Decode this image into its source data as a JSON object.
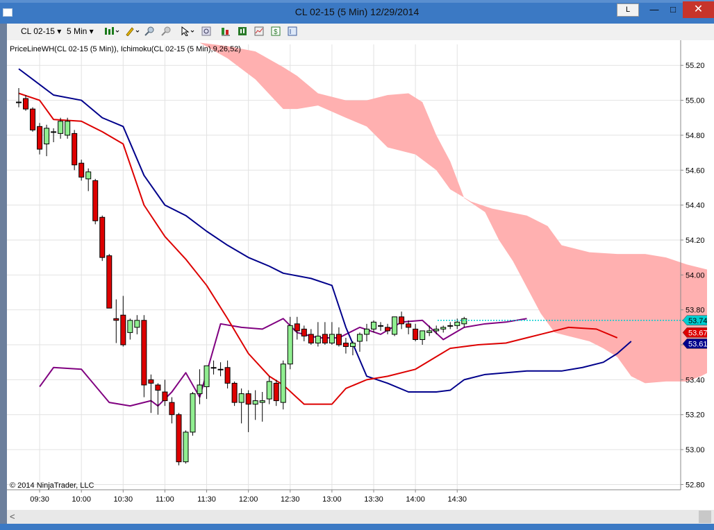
{
  "window": {
    "title": "CL 02-15 (5 Min)  12/29/2014",
    "l_button_label": "L",
    "minimize_icon": "minimize-icon",
    "maximize_icon": "maximize-icon",
    "close_icon": "close-icon"
  },
  "toolbar": {
    "instrument": "CL 02-15",
    "interval": "5 Min",
    "icons": [
      "bar-type-icon",
      "pencil-icon",
      "zoom-in-icon",
      "zoom-out-icon",
      "cursor-icon",
      "magnifier-icon",
      "properties-icon",
      "strategy-icon",
      "chart-trader-icon",
      "dollar-icon",
      "data-box-icon"
    ]
  },
  "colors": {
    "bull_candle": "#90ee90",
    "bear_candle": "#dd0000",
    "kumo_cloud": "#ffb0b0",
    "kijun": "#00008b",
    "tenkan": "#dd0000",
    "chikou": "#800080",
    "priceline": "#00ced1"
  },
  "chart_data": {
    "type": "candlestick",
    "indicator_label": "PriceLineWH(CL 02-15 (5 Min)),  Ichimoku(CL 02-15 (5 Min),9,26,52)",
    "copyright": "© 2014 NinjaTrader, LLC",
    "x_tick_labels": [
      "09:30",
      "10:00",
      "10:30",
      "11:00",
      "11:30",
      "12:00",
      "12:30",
      "13:00",
      "13:30",
      "14:00",
      "14:30"
    ],
    "y_tick_labels": [
      "55.20",
      "55.00",
      "54.80",
      "54.60",
      "54.40",
      "54.20",
      "54.00",
      "53.80",
      "53.60",
      "53.40",
      "53.20",
      "53.00",
      "52.80"
    ],
    "ylim": [
      52.77,
      55.32
    ],
    "grid": true,
    "start_time": "09:15",
    "bar_minutes": 5,
    "candles": [
      {
        "o": 54.99,
        "h": 55.07,
        "l": 54.96,
        "c": 54.99
      },
      {
        "o": 55.01,
        "h": 55.03,
        "l": 54.94,
        "c": 54.95
      },
      {
        "o": 54.95,
        "h": 54.96,
        "l": 54.82,
        "c": 54.83
      },
      {
        "o": 54.85,
        "h": 54.87,
        "l": 54.69,
        "c": 54.72
      },
      {
        "o": 54.75,
        "h": 54.86,
        "l": 54.68,
        "c": 54.84
      },
      {
        "o": 54.82,
        "h": 54.84,
        "l": 54.76,
        "c": 54.82
      },
      {
        "o": 54.81,
        "h": 54.9,
        "l": 54.78,
        "c": 54.88
      },
      {
        "o": 54.8,
        "h": 54.9,
        "l": 54.78,
        "c": 54.88
      },
      {
        "o": 54.81,
        "h": 54.83,
        "l": 54.6,
        "c": 54.63
      },
      {
        "o": 54.64,
        "h": 54.66,
        "l": 54.54,
        "c": 54.56
      },
      {
        "o": 54.55,
        "h": 54.61,
        "l": 54.48,
        "c": 54.59
      },
      {
        "o": 54.54,
        "h": 54.55,
        "l": 54.29,
        "c": 54.31
      },
      {
        "o": 54.33,
        "h": 54.34,
        "l": 54.08,
        "c": 54.1
      },
      {
        "o": 54.11,
        "h": 54.12,
        "l": 53.81,
        "c": 53.81
      },
      {
        "o": 53.75,
        "h": 53.86,
        "l": 53.61,
        "c": 53.74
      },
      {
        "o": 53.77,
        "h": 53.88,
        "l": 53.59,
        "c": 53.6
      },
      {
        "o": 53.67,
        "h": 53.75,
        "l": 53.63,
        "c": 53.74
      },
      {
        "o": 53.7,
        "h": 53.77,
        "l": 53.66,
        "c": 53.74
      },
      {
        "o": 53.74,
        "h": 53.77,
        "l": 53.3,
        "c": 53.37
      },
      {
        "o": 53.4,
        "h": 53.43,
        "l": 53.21,
        "c": 53.38
      },
      {
        "o": 53.37,
        "h": 53.38,
        "l": 53.2,
        "c": 53.34
      },
      {
        "o": 53.33,
        "h": 53.4,
        "l": 53.25,
        "c": 53.28
      },
      {
        "o": 53.27,
        "h": 53.3,
        "l": 53.15,
        "c": 53.2
      },
      {
        "o": 53.2,
        "h": 53.21,
        "l": 52.91,
        "c": 52.93
      },
      {
        "o": 52.93,
        "h": 53.11,
        "l": 52.92,
        "c": 53.1
      },
      {
        "o": 53.1,
        "h": 53.33,
        "l": 53.08,
        "c": 53.32
      },
      {
        "o": 53.32,
        "h": 53.46,
        "l": 53.26,
        "c": 53.37
      },
      {
        "o": 53.36,
        "h": 53.48,
        "l": 53.29,
        "c": 53.48
      },
      {
        "o": 53.47,
        "h": 53.51,
        "l": 53.43,
        "c": 53.47
      },
      {
        "o": 53.46,
        "h": 53.5,
        "l": 53.42,
        "c": 53.46
      },
      {
        "o": 53.47,
        "h": 53.51,
        "l": 53.35,
        "c": 53.38
      },
      {
        "o": 53.38,
        "h": 53.39,
        "l": 53.25,
        "c": 53.27
      },
      {
        "o": 53.27,
        "h": 53.35,
        "l": 53.15,
        "c": 53.32
      },
      {
        "o": 53.32,
        "h": 53.34,
        "l": 53.1,
        "c": 53.26
      },
      {
        "o": 53.26,
        "h": 53.34,
        "l": 53.17,
        "c": 53.28
      },
      {
        "o": 53.27,
        "h": 53.33,
        "l": 53.16,
        "c": 53.28
      },
      {
        "o": 53.29,
        "h": 53.42,
        "l": 53.26,
        "c": 53.39
      },
      {
        "o": 53.38,
        "h": 53.4,
        "l": 53.25,
        "c": 53.28
      },
      {
        "o": 53.27,
        "h": 53.51,
        "l": 53.23,
        "c": 53.49
      },
      {
        "o": 53.49,
        "h": 53.76,
        "l": 53.46,
        "c": 53.71
      },
      {
        "o": 53.72,
        "h": 53.76,
        "l": 53.63,
        "c": 53.68
      },
      {
        "o": 53.69,
        "h": 53.71,
        "l": 53.62,
        "c": 53.65
      },
      {
        "o": 53.66,
        "h": 53.69,
        "l": 53.6,
        "c": 53.61
      },
      {
        "o": 53.61,
        "h": 53.73,
        "l": 53.59,
        "c": 53.65
      },
      {
        "o": 53.66,
        "h": 53.73,
        "l": 53.6,
        "c": 53.61
      },
      {
        "o": 53.61,
        "h": 53.73,
        "l": 53.6,
        "c": 53.66
      },
      {
        "o": 53.66,
        "h": 53.7,
        "l": 53.59,
        "c": 53.6
      },
      {
        "o": 53.61,
        "h": 53.64,
        "l": 53.55,
        "c": 53.59
      },
      {
        "o": 53.59,
        "h": 53.62,
        "l": 53.54,
        "c": 53.61
      },
      {
        "o": 53.62,
        "h": 53.67,
        "l": 53.56,
        "c": 53.66
      },
      {
        "o": 53.66,
        "h": 53.72,
        "l": 53.62,
        "c": 53.69
      },
      {
        "o": 53.69,
        "h": 53.74,
        "l": 53.67,
        "c": 53.73
      },
      {
        "o": 53.71,
        "h": 53.73,
        "l": 53.68,
        "c": 53.71
      },
      {
        "o": 53.7,
        "h": 53.72,
        "l": 53.66,
        "c": 53.68
      },
      {
        "o": 53.66,
        "h": 53.76,
        "l": 53.65,
        "c": 53.76
      },
      {
        "o": 53.76,
        "h": 53.79,
        "l": 53.69,
        "c": 53.72
      },
      {
        "o": 53.72,
        "h": 53.74,
        "l": 53.66,
        "c": 53.7
      },
      {
        "o": 53.69,
        "h": 53.72,
        "l": 53.62,
        "c": 53.63
      },
      {
        "o": 53.63,
        "h": 53.67,
        "l": 53.6,
        "c": 53.68
      },
      {
        "o": 53.67,
        "h": 53.71,
        "l": 53.65,
        "c": 53.68
      },
      {
        "o": 53.68,
        "h": 53.71,
        "l": 53.66,
        "c": 53.69
      },
      {
        "o": 53.69,
        "h": 53.71,
        "l": 53.67,
        "c": 53.7
      },
      {
        "o": 53.71,
        "h": 53.73,
        "l": 53.69,
        "c": 53.71
      },
      {
        "o": 53.71,
        "h": 53.75,
        "l": 53.69,
        "c": 53.73
      },
      {
        "o": 53.72,
        "h": 53.76,
        "l": 53.7,
        "c": 53.75
      }
    ],
    "kijun_sen": [
      [
        0,
        55.18
      ],
      [
        2,
        55.12
      ],
      [
        5,
        55.03
      ],
      [
        9,
        55.0
      ],
      [
        12,
        54.9
      ],
      [
        15,
        54.85
      ],
      [
        18,
        54.57
      ],
      [
        21,
        54.4
      ],
      [
        24,
        54.34
      ],
      [
        27,
        54.25
      ],
      [
        30,
        54.17
      ],
      [
        33,
        54.1
      ],
      [
        36,
        54.05
      ],
      [
        38,
        54.01
      ],
      [
        42,
        53.98
      ],
      [
        45,
        53.94
      ],
      [
        47,
        53.7
      ],
      [
        50,
        53.42
      ],
      [
        53,
        53.38
      ],
      [
        56,
        53.33
      ],
      [
        60,
        53.33
      ],
      [
        62,
        53.34
      ],
      [
        64,
        53.4
      ],
      [
        67,
        53.43
      ],
      [
        73,
        53.45
      ],
      [
        78,
        53.45
      ],
      [
        81,
        53.47
      ],
      [
        84,
        53.5
      ],
      [
        86,
        53.55
      ],
      [
        88,
        53.62
      ]
    ],
    "tenkan_sen": [
      [
        0,
        55.04
      ],
      [
        3,
        55.0
      ],
      [
        5,
        54.89
      ],
      [
        9,
        54.88
      ],
      [
        12,
        54.82
      ],
      [
        15,
        54.75
      ],
      [
        18,
        54.4
      ],
      [
        21,
        54.22
      ],
      [
        24,
        54.09
      ],
      [
        27,
        53.94
      ],
      [
        30,
        53.75
      ],
      [
        33,
        53.55
      ],
      [
        36,
        53.42
      ],
      [
        38,
        53.37
      ],
      [
        41,
        53.26
      ],
      [
        45,
        53.26
      ],
      [
        47,
        53.35
      ],
      [
        50,
        53.4
      ],
      [
        53,
        53.42
      ],
      [
        57,
        53.46
      ],
      [
        62,
        53.58
      ],
      [
        66,
        53.6
      ],
      [
        70,
        53.61
      ],
      [
        75,
        53.66
      ],
      [
        79,
        53.7
      ],
      [
        83,
        53.69
      ],
      [
        86,
        53.64
      ]
    ],
    "chikou_span": [
      [
        3,
        53.36
      ],
      [
        5,
        53.47
      ],
      [
        9,
        53.46
      ],
      [
        13,
        53.27
      ],
      [
        16,
        53.25
      ],
      [
        19,
        53.28
      ],
      [
        20,
        53.25
      ],
      [
        22,
        53.33
      ],
      [
        24,
        53.44
      ],
      [
        26,
        53.3
      ],
      [
        29,
        53.72
      ],
      [
        32,
        53.7
      ],
      [
        35,
        53.69
      ],
      [
        38,
        53.75
      ],
      [
        40,
        53.67
      ],
      [
        43,
        53.64
      ],
      [
        46,
        53.64
      ],
      [
        49,
        53.7
      ],
      [
        52,
        53.66
      ],
      [
        55,
        53.73
      ],
      [
        58,
        53.74
      ],
      [
        61,
        53.63
      ],
      [
        64,
        53.7
      ],
      [
        67,
        53.72
      ],
      [
        70,
        53.73
      ],
      [
        73,
        53.75
      ]
    ],
    "kumo_upper": [
      [
        16,
        55.33
      ],
      [
        26,
        55.33
      ],
      [
        30,
        55.24
      ],
      [
        34,
        55.12
      ],
      [
        38,
        54.95
      ],
      [
        40,
        54.95
      ],
      [
        43,
        54.97
      ],
      [
        47,
        54.9
      ],
      [
        50,
        54.85
      ],
      [
        53,
        54.73
      ],
      [
        57,
        54.69
      ],
      [
        60,
        54.6
      ],
      [
        62,
        54.49
      ],
      [
        65,
        54.42
      ],
      [
        68,
        54.38
      ],
      [
        73,
        54.34
      ],
      [
        76,
        54.28
      ],
      [
        78,
        54.17
      ],
      [
        82,
        54.13
      ],
      [
        86,
        54.12
      ],
      [
        90,
        54.12
      ],
      [
        93,
        54.1
      ],
      [
        96,
        54.06
      ],
      [
        99,
        54.03
      ],
      [
        102,
        53.98
      ],
      [
        106,
        53.94
      ],
      [
        109,
        53.9
      ],
      [
        113,
        53.9
      ],
      [
        116,
        53.85
      ],
      [
        119,
        53.78
      ],
      [
        121,
        53.7
      ],
      [
        124,
        53.64
      ],
      [
        126,
        53.62
      ]
    ],
    "kumo_lower": [
      [
        16,
        55.33
      ],
      [
        26,
        55.33
      ],
      [
        30,
        55.31
      ],
      [
        34,
        55.28
      ],
      [
        38,
        55.19
      ],
      [
        40,
        55.14
      ],
      [
        43,
        55.04
      ],
      [
        47,
        55.0
      ],
      [
        50,
        55.0
      ],
      [
        53,
        55.03
      ],
      [
        56,
        55.04
      ],
      [
        58,
        54.99
      ],
      [
        60,
        54.8
      ],
      [
        62,
        54.65
      ],
      [
        64,
        54.44
      ],
      [
        67,
        54.36
      ],
      [
        69,
        54.2
      ],
      [
        71,
        54.08
      ],
      [
        73,
        53.93
      ],
      [
        75,
        53.78
      ],
      [
        77,
        53.67
      ],
      [
        79,
        53.65
      ],
      [
        82,
        53.62
      ],
      [
        84,
        53.58
      ],
      [
        86,
        53.53
      ],
      [
        88,
        53.42
      ],
      [
        90,
        53.38
      ],
      [
        93,
        53.39
      ],
      [
        96,
        53.39
      ],
      [
        98,
        53.42
      ],
      [
        101,
        53.48
      ],
      [
        104,
        53.52
      ],
      [
        107,
        53.53
      ],
      [
        110,
        53.55
      ],
      [
        113,
        53.56
      ],
      [
        116,
        53.59
      ],
      [
        119,
        53.61
      ],
      [
        121,
        53.63
      ],
      [
        123,
        53.62
      ],
      [
        125,
        53.55
      ],
      [
        126,
        53.5
      ]
    ],
    "price_line": 53.74,
    "price_labels": [
      {
        "value": 53.74,
        "text": "53.74",
        "color": "#00ced1"
      },
      {
        "value": 53.67,
        "text": "53.67",
        "color": "#dd0000"
      },
      {
        "value": 53.61,
        "text": "53.61",
        "color": "#00008b"
      }
    ]
  }
}
